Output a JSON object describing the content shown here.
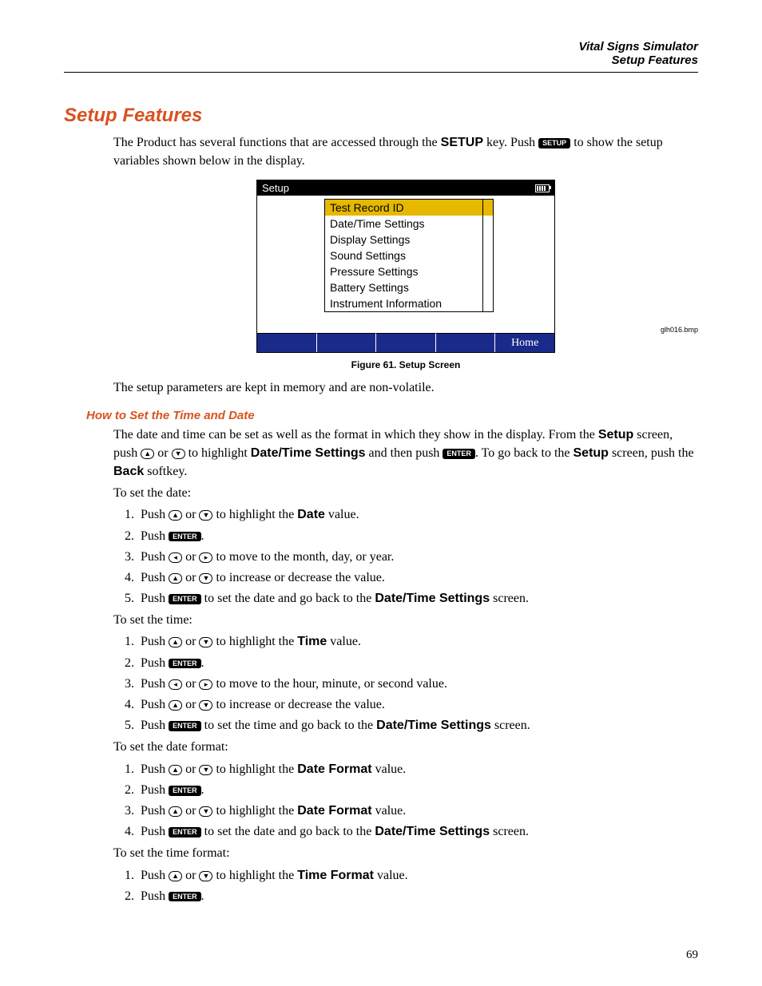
{
  "header": {
    "line1": "Vital Signs Simulator",
    "line2": "Setup Features"
  },
  "title": "Setup Features",
  "intro": {
    "part1": "The Product has several functions that are accessed through the ",
    "setup_key": "SETUP",
    "part2": " key. Push ",
    "part3": " to show the setup variables shown below in the display."
  },
  "key_labels": {
    "setup": "SETUP",
    "enter": "ENTER"
  },
  "screen": {
    "title": "Setup",
    "items": [
      "Test Record ID",
      "Date/Time Settings",
      "Display Settings",
      "Sound Settings",
      "Pressure Settings",
      "Battery Settings",
      "Instrument Information"
    ],
    "soft_home": "Home"
  },
  "bmp_label": "glh016.bmp",
  "figure_caption": "Figure 61. Setup Screen",
  "after_figure": "The setup parameters are kept in memory and are non-volatile.",
  "subheading": "How to Set the Time and Date",
  "sub_intro": {
    "a": "The date and time can be set as well as the format in which they show in the display. From the ",
    "setup_word": "Setup",
    "b": " screen, push ",
    "c": " or ",
    "d": " to highlight ",
    "dt": "Date/Time Settings",
    "e": " and then push ",
    "f": ". To go back to the ",
    "g": " screen, push the ",
    "back": "Back",
    "h": " softkey."
  },
  "labels": {
    "to_set_date": "To set the date:",
    "to_set_time": "To set the time:",
    "to_set_date_format": "To set the date format:",
    "to_set_time_format": "To set the time format:",
    "push": "Push ",
    "or": " or ",
    "highlight": " to highlight the ",
    "value": " value.",
    "period": ".",
    "move_mdy": " to move to the month, day, or year.",
    "move_hms": " to move to the hour, minute, or second value.",
    "inc_dec": " to increase or decrease the value.",
    "set_date_goback": " to set the date and go back to the ",
    "set_time_goback": " to set the time and go back to the ",
    "screen": " screen.",
    "date": "Date",
    "time": "Time",
    "date_format": "Date Format",
    "time_format": "Time Format",
    "dt_settings": "Date/Time Settings"
  },
  "page_number": "69"
}
